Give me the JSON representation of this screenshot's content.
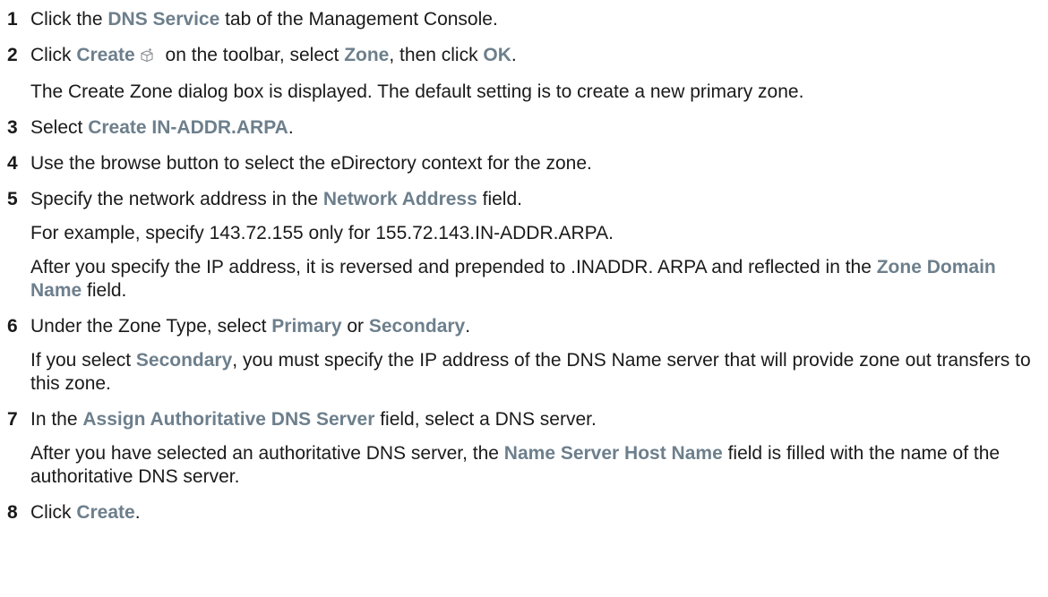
{
  "steps": [
    {
      "num": "1",
      "parts": [
        "Click the ",
        "DNS Service",
        " tab of the Management Console."
      ]
    },
    {
      "num": "2",
      "parts": [
        "Click ",
        "Create",
        " on the toolbar, select ",
        "Zone",
        ", then click ",
        "OK",
        "."
      ],
      "icon": "create-cube-icon",
      "note": "The Create Zone dialog box is displayed. The default setting is to create a new primary zone."
    },
    {
      "num": "3",
      "parts": [
        "Select ",
        "Create IN-ADDR.ARPA",
        "."
      ]
    },
    {
      "num": "4",
      "text": "Use the browse button to select the eDirectory context for the zone."
    },
    {
      "num": "5",
      "parts": [
        "Specify the network address in the ",
        "Network Address",
        " field."
      ],
      "note1": "For example, specify 143.72.155 only for 155.72.143.IN-ADDR.ARPA.",
      "note2_parts": [
        "After you specify the IP address, it is reversed and prepended to .INADDR. ARPA and reflected in the ",
        "Zone Domain Name",
        " field."
      ]
    },
    {
      "num": "6",
      "parts": [
        "Under the Zone Type, select ",
        "Primary",
        " or ",
        "Secondary",
        "."
      ],
      "note_parts": [
        "If you select ",
        "Secondary",
        ", you must specify the IP address of the DNS Name server that will provide zone out transfers to this zone."
      ]
    },
    {
      "num": "7",
      "parts": [
        "In the ",
        "Assign Authoritative DNS Server",
        " field, select a DNS server."
      ],
      "note_parts": [
        "After you have selected an authoritative DNS server, the ",
        "Name Server Host Name",
        " field is filled with the name of the authoritative DNS server."
      ]
    },
    {
      "num": "8",
      "parts": [
        "Click ",
        "Create",
        "."
      ]
    }
  ],
  "colors": {
    "ui_text": "#6d7f8c",
    "body_text": "#1a1a1a"
  }
}
